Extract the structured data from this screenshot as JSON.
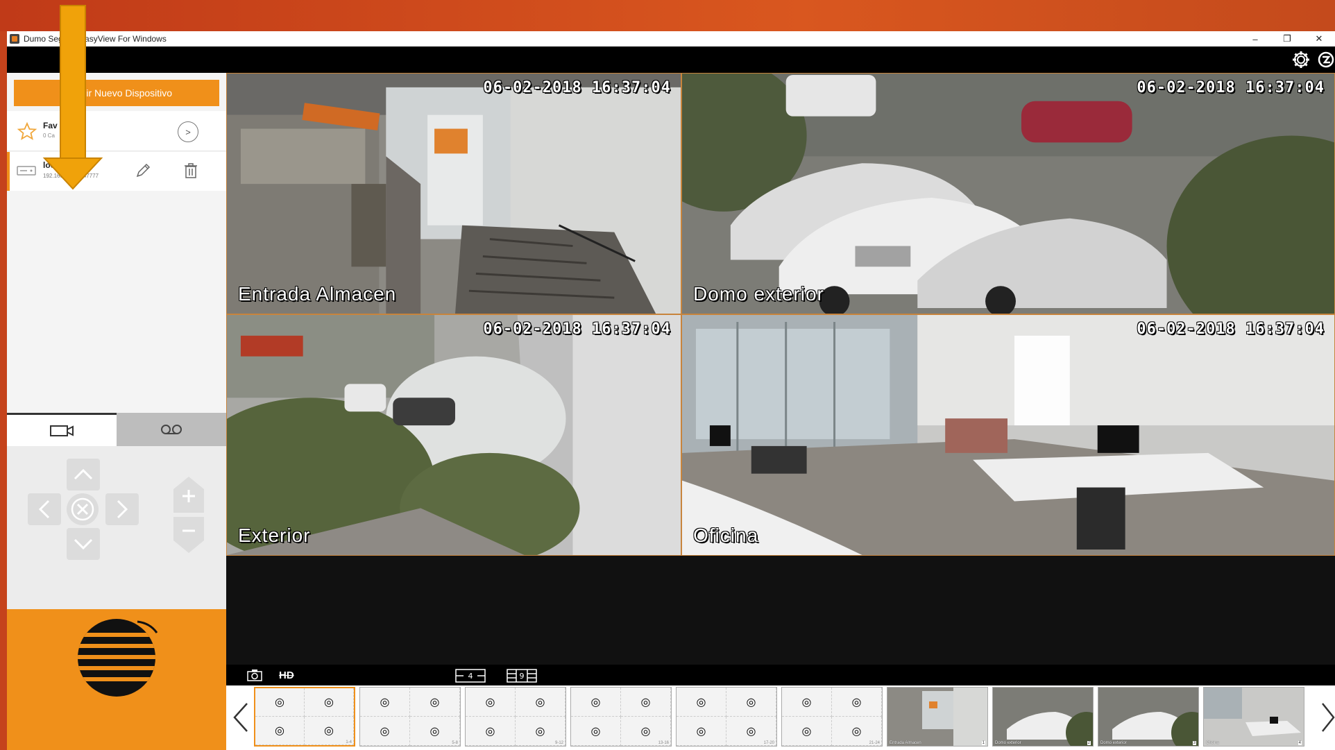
{
  "window": {
    "title": "Dumo Seg       EasyView For Windows",
    "min": "–",
    "restore": "❐",
    "close": "✕"
  },
  "sidebar": {
    "add_button": "Añadir Nuevo Dispositivo",
    "add_button_visible": "adir Nuevo Dispositivo",
    "favorites": {
      "name": "Fav",
      "sub": "0 Ca",
      "go": ">"
    },
    "device": {
      "name": "local",
      "ip": "192.168.1.208 : 47777"
    }
  },
  "cameras": [
    {
      "label": "Entrada Almacen",
      "timestamp": "06-02-2018 16:37:04"
    },
    {
      "label": "Domo exterior",
      "timestamp": "06-02-2018 16:37:04"
    },
    {
      "label": "Exterior",
      "timestamp": "06-02-2018 16:37:04"
    },
    {
      "label": "Oficina",
      "timestamp": "06-02-2018 16:37:04"
    }
  ],
  "toolbar": {
    "hd": "HD",
    "layout4": "4",
    "layout9": "9"
  },
  "thumbnails": {
    "groups": [
      "1-4",
      "5-8",
      "9-12",
      "13-16",
      "17-20",
      "21-24"
    ],
    "channels": [
      {
        "name": "Entrada Almacen",
        "num": "1"
      },
      {
        "name": "Domo exterior",
        "num": "2"
      },
      {
        "name": "Domo exterior",
        "num": "3"
      },
      {
        "name": "Oficina",
        "num": "4"
      }
    ]
  },
  "colors": {
    "accent": "#f0901a",
    "appbar": "#000000",
    "annotation": "#f0a20a"
  }
}
